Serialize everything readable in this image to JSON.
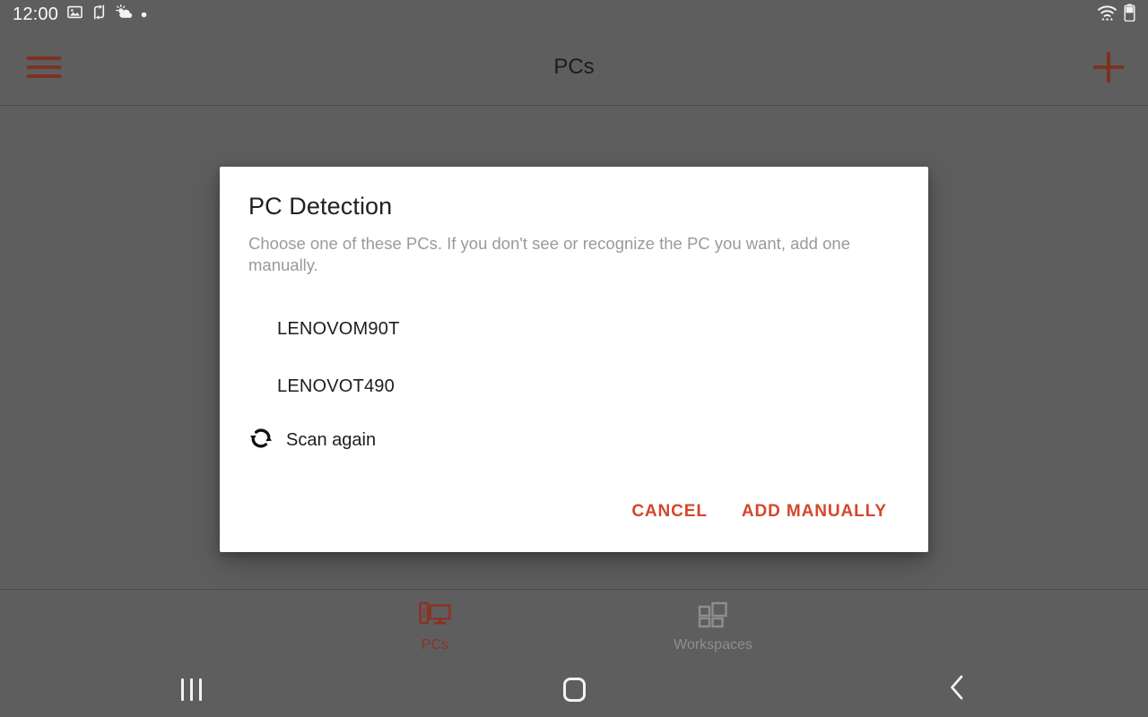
{
  "status_bar": {
    "clock": "12:00",
    "left_icons": [
      "image-icon",
      "sync-icon",
      "weather-icon",
      "dot-icon"
    ],
    "right_icons": [
      "wifi-icon",
      "battery-icon"
    ]
  },
  "app_bar": {
    "menu_icon": "hamburger-menu-icon",
    "title": "PCs",
    "add_icon": "plus-icon",
    "accent_color": "#7d3122"
  },
  "dialog": {
    "title": "PC Detection",
    "body": "Choose one of these PCs. If you don't see or recognize the PC you want, add one manually.",
    "pcs": [
      {
        "name": "LENOVOM90T"
      },
      {
        "name": "LENOVOT490"
      }
    ],
    "scan_again": {
      "icon": "sync-refresh-icon",
      "label": "Scan again"
    },
    "actions": {
      "cancel_label": "CANCEL",
      "add_manually_label": "ADD MANUALLY",
      "action_color": "#d4472a"
    }
  },
  "tab_bar": {
    "tabs": [
      {
        "label": "PCs",
        "icon": "desktop-pc-icon",
        "selected": true,
        "color": "#8a3322"
      },
      {
        "label": "Workspaces",
        "icon": "grid-dashboard-icon",
        "selected": false,
        "color": "#8e8e8e"
      }
    ]
  },
  "nav_bar": {
    "recents_icon": "recents-icon",
    "home_icon": "home-icon",
    "back_icon": "back-icon"
  },
  "colors": {
    "scrim": "#5e5e5e",
    "dialog_bg": "#ffffff",
    "accent": "#d4472a"
  }
}
